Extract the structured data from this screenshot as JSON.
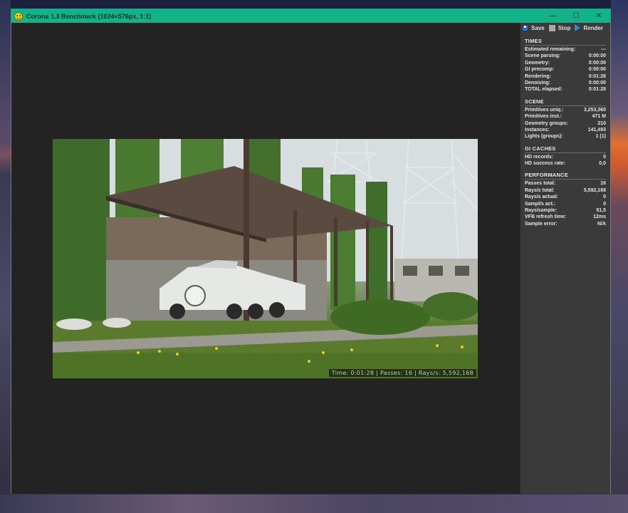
{
  "window": {
    "title": "Corona 1.3 Benchmark (1024×576px, 1:1)",
    "controls": {
      "minimize": "—",
      "maximize": "☐",
      "close": "✕"
    }
  },
  "toolbar": {
    "save_label": "Save",
    "stop_label": "Stop",
    "render_label": "Render"
  },
  "render": {
    "overlay_text": "Time: 0:01:28 | Passes: 16 | Rays/s: 5,592,168"
  },
  "panel": {
    "times": {
      "title": "TIMES",
      "rows": [
        {
          "label": "Estimated remaining:",
          "value": "---"
        },
        {
          "label": "Scene parsing:",
          "value": "0:00:00"
        },
        {
          "label": "Geometry:",
          "value": "0:00:00"
        },
        {
          "label": "GI precomp:",
          "value": "0:00:00"
        },
        {
          "label": "Rendering:",
          "value": "0:01:26"
        },
        {
          "label": "Denoising:",
          "value": "0:00:00"
        },
        {
          "label": "TOTAL elapsed:",
          "value": "0:01:28"
        }
      ]
    },
    "scene": {
      "title": "SCENE",
      "rows": [
        {
          "label": "Primitives uniq.:",
          "value": "3,253,360"
        },
        {
          "label": "Primitives inst.:",
          "value": "471 M"
        },
        {
          "label": "Geometry groups:",
          "value": "210"
        },
        {
          "label": "Instances:",
          "value": "141,493"
        },
        {
          "label": "Lights (groups):",
          "value": "1 (1)"
        }
      ]
    },
    "gi_caches": {
      "title": "GI CACHES",
      "rows": [
        {
          "label": "HD records:",
          "value": "0"
        },
        {
          "label": "HD success rate:",
          "value": "0,0"
        }
      ]
    },
    "performance": {
      "title": "PERFORMANCE",
      "rows": [
        {
          "label": "Passes total:",
          "value": "16"
        },
        {
          "label": "Rays/s total:",
          "value": "5,592,168"
        },
        {
          "label": "Rays/s actual:",
          "value": "0"
        },
        {
          "label": "Sampl/s act.:",
          "value": "0"
        },
        {
          "label": "Rays/sample:",
          "value": "51,5"
        },
        {
          "label": "VFB refresh time:",
          "value": "12ms"
        },
        {
          "label": "Sample error:",
          "value": "N/A"
        }
      ]
    }
  },
  "colors": {
    "titlebar": "#12b388",
    "panel_bg": "#3a3a3a",
    "render_bg": "#232323"
  }
}
